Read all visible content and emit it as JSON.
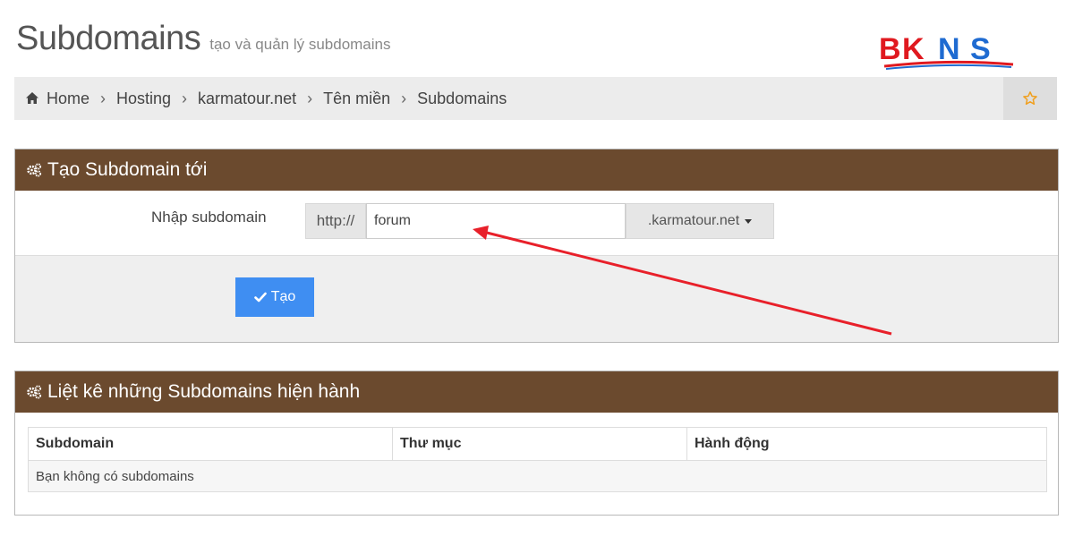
{
  "header": {
    "title": "Subdomains",
    "subtitle": "tạo và quản lý subdomains"
  },
  "logo": {
    "text": "BKNS",
    "color_red": "#e0191f",
    "color_blue": "#1f6bd1"
  },
  "breadcrumb": {
    "items": [
      "Home",
      "Hosting",
      "karmatour.net",
      "Tên miền",
      "Subdomains"
    ],
    "home_icon": "home-icon",
    "favorite_icon": "star-icon"
  },
  "create_panel": {
    "title": "Tạo Subdomain tới",
    "icon": "gears-icon",
    "field_label": "Nhập subdomain",
    "prefix": "http://",
    "input_value": "forum",
    "domain_select": ".karmatour.net",
    "submit_label": "Tạo"
  },
  "list_panel": {
    "title": "Liệt kê những Subdomains hiện hành",
    "icon": "gears-icon",
    "columns": [
      "Subdomain",
      "Thư mục",
      "Hành động"
    ],
    "empty_message": "Bạn không có subdomains"
  },
  "colors": {
    "panel_header": "#6b4a2e",
    "button": "#3f8ef2",
    "annotation_arrow": "#e8202a"
  }
}
